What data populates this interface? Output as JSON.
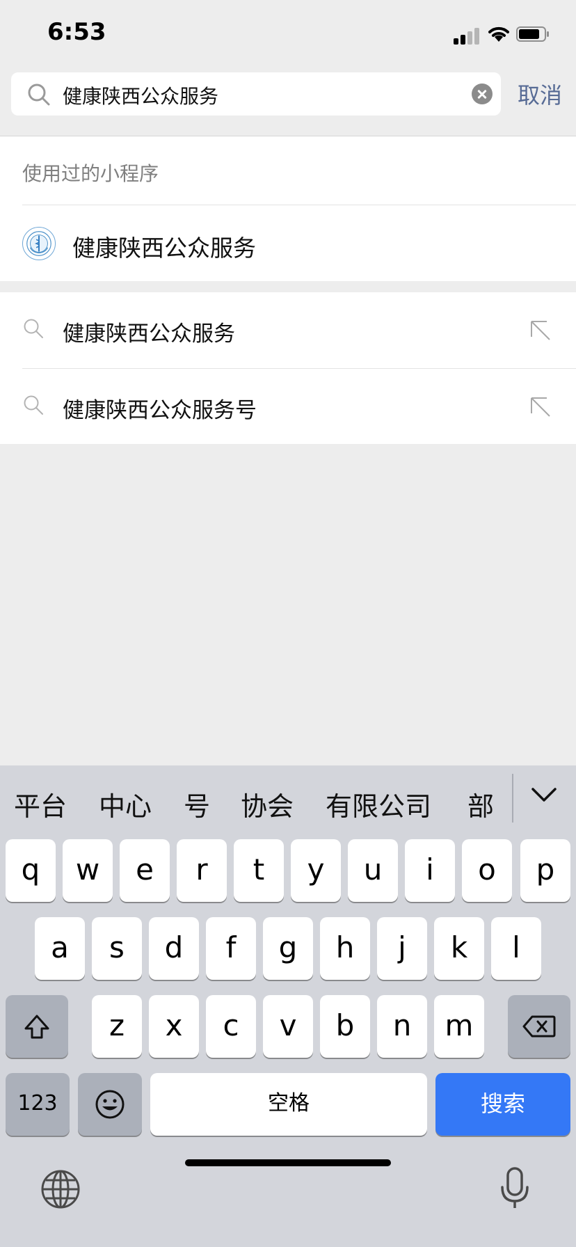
{
  "status": {
    "time": "6:53"
  },
  "search": {
    "query": "健康陕西公众服务",
    "cancel_label": "取消"
  },
  "used_section": {
    "title": "使用过的小程序",
    "item": {
      "name": "健康陕西公众服务"
    }
  },
  "suggestions": [
    {
      "text": "健康陕西公众服务"
    },
    {
      "text": "健康陕西公众服务号"
    }
  ],
  "keyboard": {
    "candidates": [
      "平台",
      "中心",
      "号",
      "协会",
      "有限公司",
      "部"
    ],
    "row1": [
      "q",
      "w",
      "e",
      "r",
      "t",
      "y",
      "u",
      "i",
      "o",
      "p"
    ],
    "row2": [
      "a",
      "s",
      "d",
      "f",
      "g",
      "h",
      "j",
      "k",
      "l"
    ],
    "row3": [
      "z",
      "x",
      "c",
      "v",
      "b",
      "n",
      "m"
    ],
    "numbers_label": "123",
    "space_label": "空格",
    "search_label": "搜索"
  },
  "colors": {
    "accent_blue": "#3478f6",
    "cancel_blue": "#576b95"
  }
}
